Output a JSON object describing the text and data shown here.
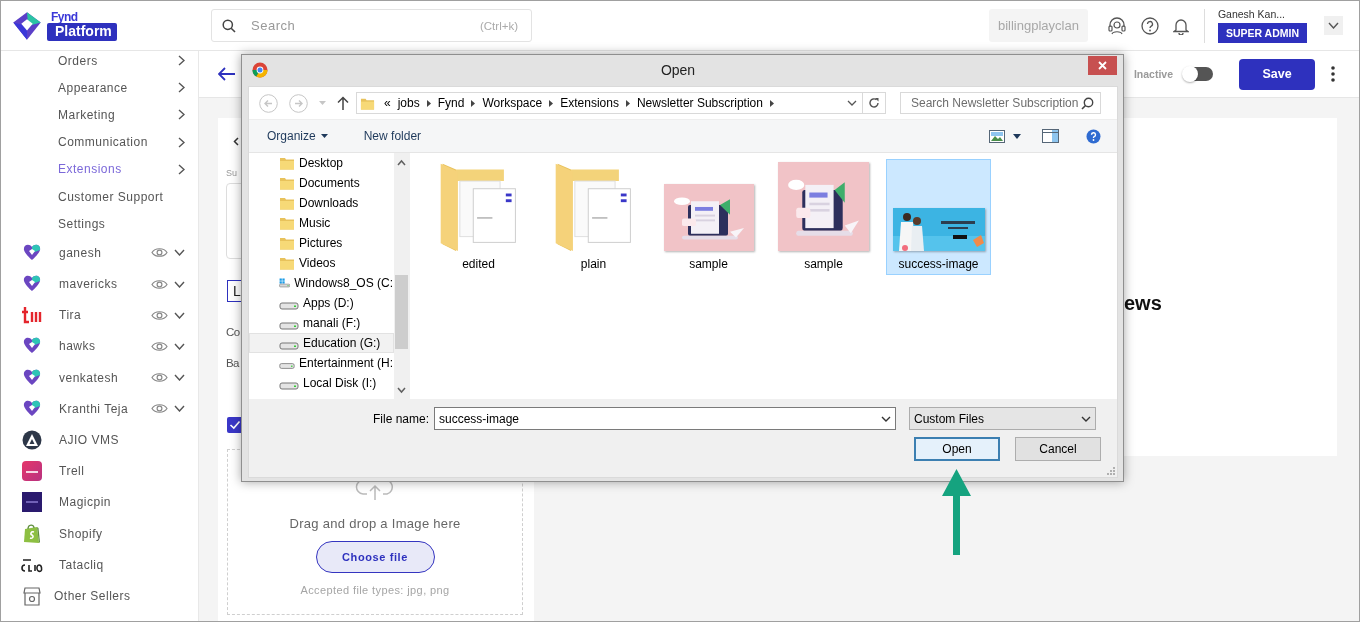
{
  "header": {
    "logo": {
      "wordmark": "Fynd",
      "badge": "Platform"
    },
    "search": {
      "placeholder": "Search",
      "shortcut": "(Ctrl+k)"
    },
    "company": "billingplayclan",
    "user": {
      "name": "Ganesh Kan...",
      "role": "SUPER ADMIN"
    }
  },
  "sidebar": {
    "menu": [
      {
        "label": "Orders",
        "selected": false,
        "submenu": true
      },
      {
        "label": "Appearance",
        "selected": false,
        "submenu": true
      },
      {
        "label": "Marketing",
        "selected": false,
        "submenu": true
      },
      {
        "label": "Communication",
        "selected": false,
        "submenu": true
      },
      {
        "label": "Extensions",
        "selected": true,
        "submenu": true
      },
      {
        "label": "Customer Support",
        "selected": false,
        "submenu": false
      },
      {
        "label": "Settings",
        "selected": false,
        "submenu": false
      }
    ],
    "channels": [
      {
        "name": "ganesh",
        "kind": "fynd",
        "controls": true
      },
      {
        "name": "mavericks",
        "kind": "fynd",
        "controls": true
      },
      {
        "name": "Tira",
        "kind": "tira",
        "controls": true
      },
      {
        "name": "hawks",
        "kind": "fynd",
        "controls": true
      },
      {
        "name": "venkatesh",
        "kind": "fynd",
        "controls": true
      },
      {
        "name": "Kranthi Teja",
        "kind": "fynd",
        "controls": true
      },
      {
        "name": "AJIO VMS",
        "kind": "ajio",
        "controls": false
      },
      {
        "name": "Trell",
        "kind": "trell",
        "controls": false
      },
      {
        "name": "Magicpin",
        "kind": "magicpin",
        "controls": false
      },
      {
        "name": "Shopify",
        "kind": "shopify",
        "controls": false
      },
      {
        "name": "Tatacliq",
        "kind": "tatacliq",
        "controls": false
      },
      {
        "name": "Other Sellers",
        "kind": "store",
        "controls": false
      }
    ]
  },
  "page": {
    "status": {
      "label": "Inactive",
      "on": false
    },
    "save": "Save",
    "section_label": "Su",
    "input_value": "L",
    "label_1": "Co",
    "label_2": "Ba",
    "checkbox": {
      "checked": true
    },
    "upload": {
      "hint": "Drag and drop a Image here",
      "button": "Choose file",
      "accepted": "Accepted file types: jpg, png"
    },
    "heading": "ews"
  },
  "dialog": {
    "title": "Open",
    "address": {
      "prefix": "«",
      "path": [
        "jobs",
        "Fynd",
        "Workspace",
        "Extensions",
        "Newsletter Subscription"
      ]
    },
    "search": {
      "placeholder": "Search Newsletter Subscription"
    },
    "toolbar": {
      "organize": "Organize",
      "new_folder": "New folder"
    },
    "nav": [
      {
        "label": "Desktop",
        "kind": "library",
        "selected": false
      },
      {
        "label": "Documents",
        "kind": "library",
        "selected": false
      },
      {
        "label": "Downloads",
        "kind": "library",
        "selected": false
      },
      {
        "label": "Music",
        "kind": "library",
        "selected": false
      },
      {
        "label": "Pictures",
        "kind": "library",
        "selected": false
      },
      {
        "label": "Videos",
        "kind": "library",
        "selected": false
      },
      {
        "label": "Windows8_OS (C:",
        "kind": "system_drive",
        "selected": false
      },
      {
        "label": "Apps (D:)",
        "kind": "drive",
        "selected": false
      },
      {
        "label": "manali (F:)",
        "kind": "drive",
        "selected": false
      },
      {
        "label": "Education (G:)",
        "kind": "drive",
        "selected": true
      },
      {
        "label": "Entertainment (H:",
        "kind": "drive",
        "selected": false
      },
      {
        "label": "Local Disk (I:)",
        "kind": "drive",
        "selected": false
      }
    ],
    "files": [
      {
        "name": "edited",
        "kind": "folder",
        "selected": false
      },
      {
        "name": "plain",
        "kind": "folder",
        "selected": false
      },
      {
        "name": "sample",
        "kind": "picture",
        "selected": false
      },
      {
        "name": "sample",
        "kind": "picture",
        "selected": false
      },
      {
        "name": "success-image",
        "kind": "picture",
        "selected": true
      }
    ],
    "file_name": {
      "label": "File name:",
      "value": "success-image"
    },
    "file_type": "Custom Files",
    "buttons": [
      {
        "label": "Open",
        "default": true
      },
      {
        "label": "Cancel",
        "default": false
      }
    ]
  }
}
